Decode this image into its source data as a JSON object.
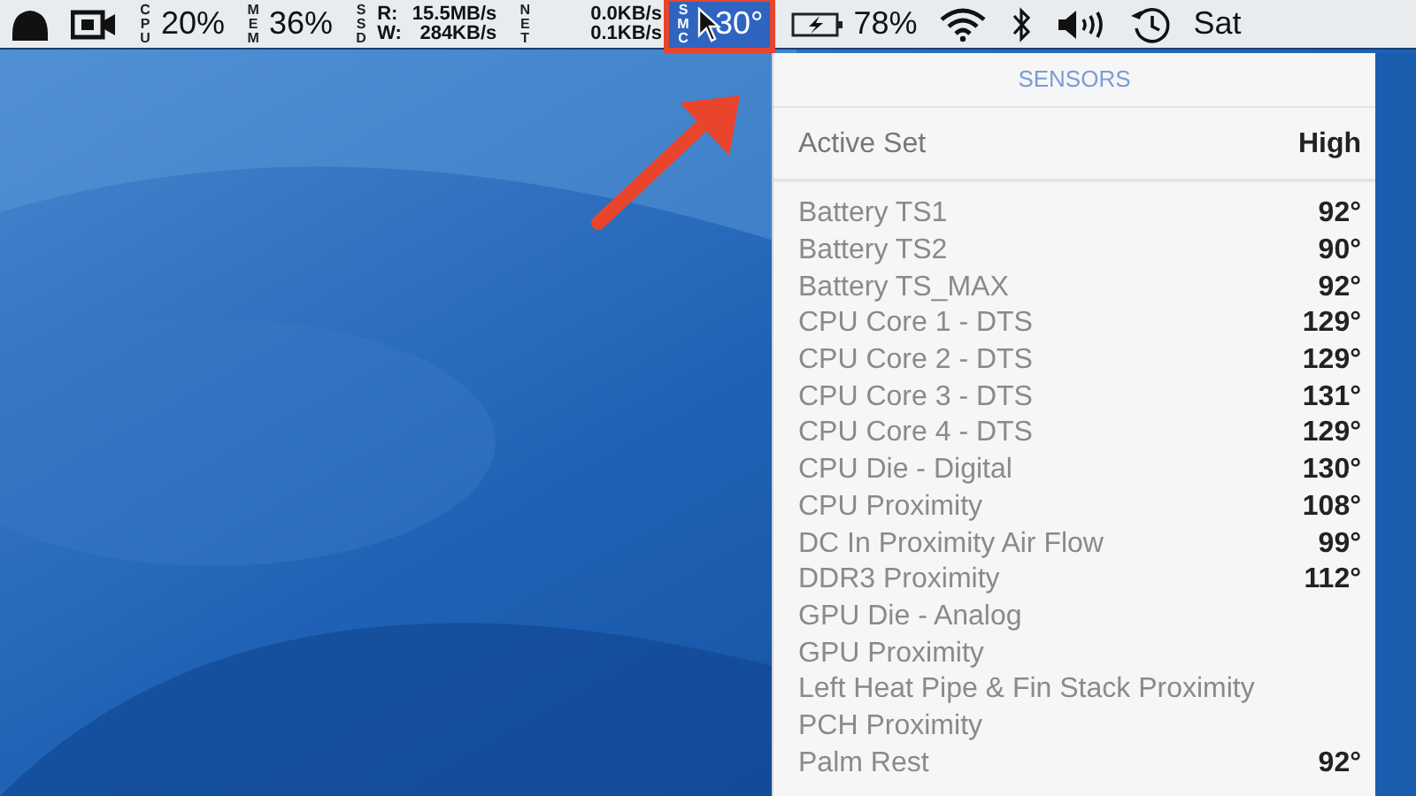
{
  "menu_bar": {
    "cpu": {
      "label": "CPU",
      "value": "20%"
    },
    "mem": {
      "label": "MEM",
      "value": "36%"
    },
    "ssd": {
      "label": "SSD",
      "read": "R:",
      "read_value": "15.5MB/s",
      "write": "W:",
      "write_value": "284KB/s"
    },
    "net": {
      "label": "NET",
      "down": "0.0KB/s",
      "up": "0.1KB/s"
    },
    "sensors": {
      "label": "SMC",
      "value": "30°",
      "selected": true
    },
    "battery": {
      "value": "78%"
    },
    "clock": "Sat"
  },
  "sensors_menu": {
    "title": "SENSORS",
    "active_set": {
      "label": "Active Set",
      "value": "High"
    },
    "rows": [
      {
        "name": "Battery TS1",
        "value": "92°"
      },
      {
        "name": "Battery TS2",
        "value": "90°"
      },
      {
        "name": "Battery TS_MAX",
        "value": "92°"
      },
      {
        "name": "CPU Core 1 - DTS",
        "value": "129°"
      },
      {
        "name": "CPU Core 2 - DTS",
        "value": "129°"
      },
      {
        "name": "CPU Core 3 - DTS",
        "value": "131°"
      },
      {
        "name": "CPU Core 4 - DTS",
        "value": "129°"
      },
      {
        "name": "CPU Die - Digital",
        "value": "130°"
      },
      {
        "name": "CPU Proximity",
        "value": "108°"
      },
      {
        "name": "DC In Proximity Air Flow",
        "value": "99°"
      },
      {
        "name": "DDR3 Proximity",
        "value": "112°"
      },
      {
        "name": "GPU Die - Analog"
      },
      {
        "name": "GPU Proximity"
      },
      {
        "name": "Left Heat Pipe & Fin Stack Proximity"
      },
      {
        "name": "PCH Proximity"
      },
      {
        "name": "Palm Rest",
        "value": "92°"
      }
    ]
  }
}
